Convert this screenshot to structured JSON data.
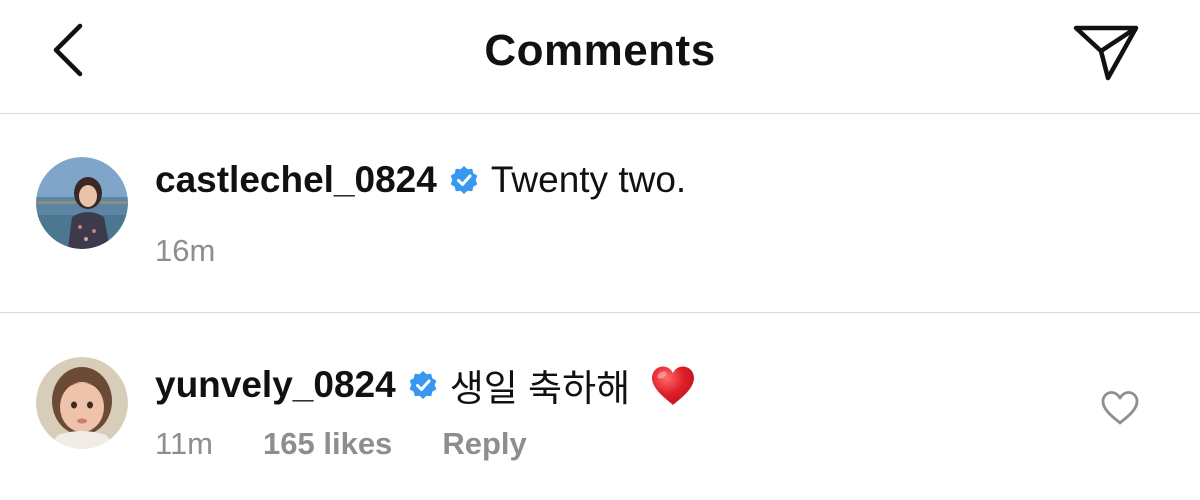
{
  "header": {
    "title": "Comments",
    "back_icon": "chevron-left-icon",
    "send_icon": "paper-plane-icon"
  },
  "comments": [
    {
      "username": "castlechel_0824",
      "verified": true,
      "text": "Twenty two.",
      "time": "16m",
      "avatar_desc": "profile photo by the sea"
    },
    {
      "username": "yunvely_0824",
      "verified": true,
      "text": "생일 축하해",
      "emoji": "red-heart",
      "time": "11m",
      "likes": "165 likes",
      "reply_label": "Reply",
      "like_icon": "heart-outline-icon"
    }
  ],
  "colors": {
    "verified_blue": "#3897f0",
    "meta_gray": "#8e8e8e",
    "divider": "#dbdbdb",
    "heart_red": "#e0202b"
  }
}
